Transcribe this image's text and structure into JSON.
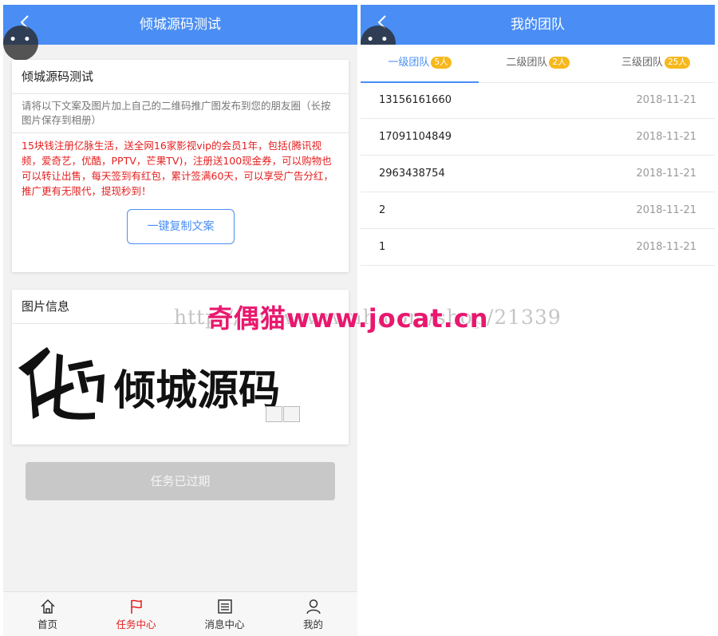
{
  "left": {
    "header_title": "倾城源码测试",
    "more_dots": "• • •",
    "card1": {
      "title": "倾城源码测试",
      "tip": "请将以下文案及图片加上自己的二维码推广图发布到您的朋友圈（长按图片保存到相册）",
      "copy_text": "15块钱注册亿脉生活，送全网16家影视vip的会员1年，包括(腾讯视频，爱奇艺，优酷，PPTV，芒果TV)，注册送100现金券，可以购物也可以转让出售，每天签到有红包，累计签满60天，可以享受广告分红，推广更有无限代，提现秒到！",
      "copy_button": "一键复制文案"
    },
    "card2": {
      "title": "图片信息",
      "image_text": "倾城源码"
    },
    "expired_button": "任务已过期",
    "tabbar": [
      {
        "label": "首页",
        "icon": "home-icon"
      },
      {
        "label": "任务中心",
        "icon": "flag-icon"
      },
      {
        "label": "消息中心",
        "icon": "message-list-icon"
      },
      {
        "label": "我的",
        "icon": "user-icon"
      }
    ]
  },
  "right": {
    "header_title": "我的团队",
    "more_dots": "• • •",
    "tabs": [
      {
        "label": "一级团队",
        "badge": "5人"
      },
      {
        "label": "二级团队",
        "badge": "2人"
      },
      {
        "label": "三级团队",
        "badge": "25人"
      }
    ],
    "members": [
      {
        "id": "13156161660",
        "date": "2018-11-21"
      },
      {
        "id": "17091104849",
        "date": "2018-11-21"
      },
      {
        "id": "2963438754",
        "date": "2018-11-21"
      },
      {
        "id": "2",
        "date": "2018-11-21"
      },
      {
        "id": "1",
        "date": "2018-11-21"
      }
    ]
  },
  "watermark": {
    "faint": "http://www.wnwnh.com/shop/21339",
    "main": "奇偶猫www.jocat.cn"
  },
  "colors": {
    "primary": "#4a8ef5",
    "danger": "#e41f1f",
    "badge": "#f6b81c",
    "watermark": "#e8186e"
  }
}
